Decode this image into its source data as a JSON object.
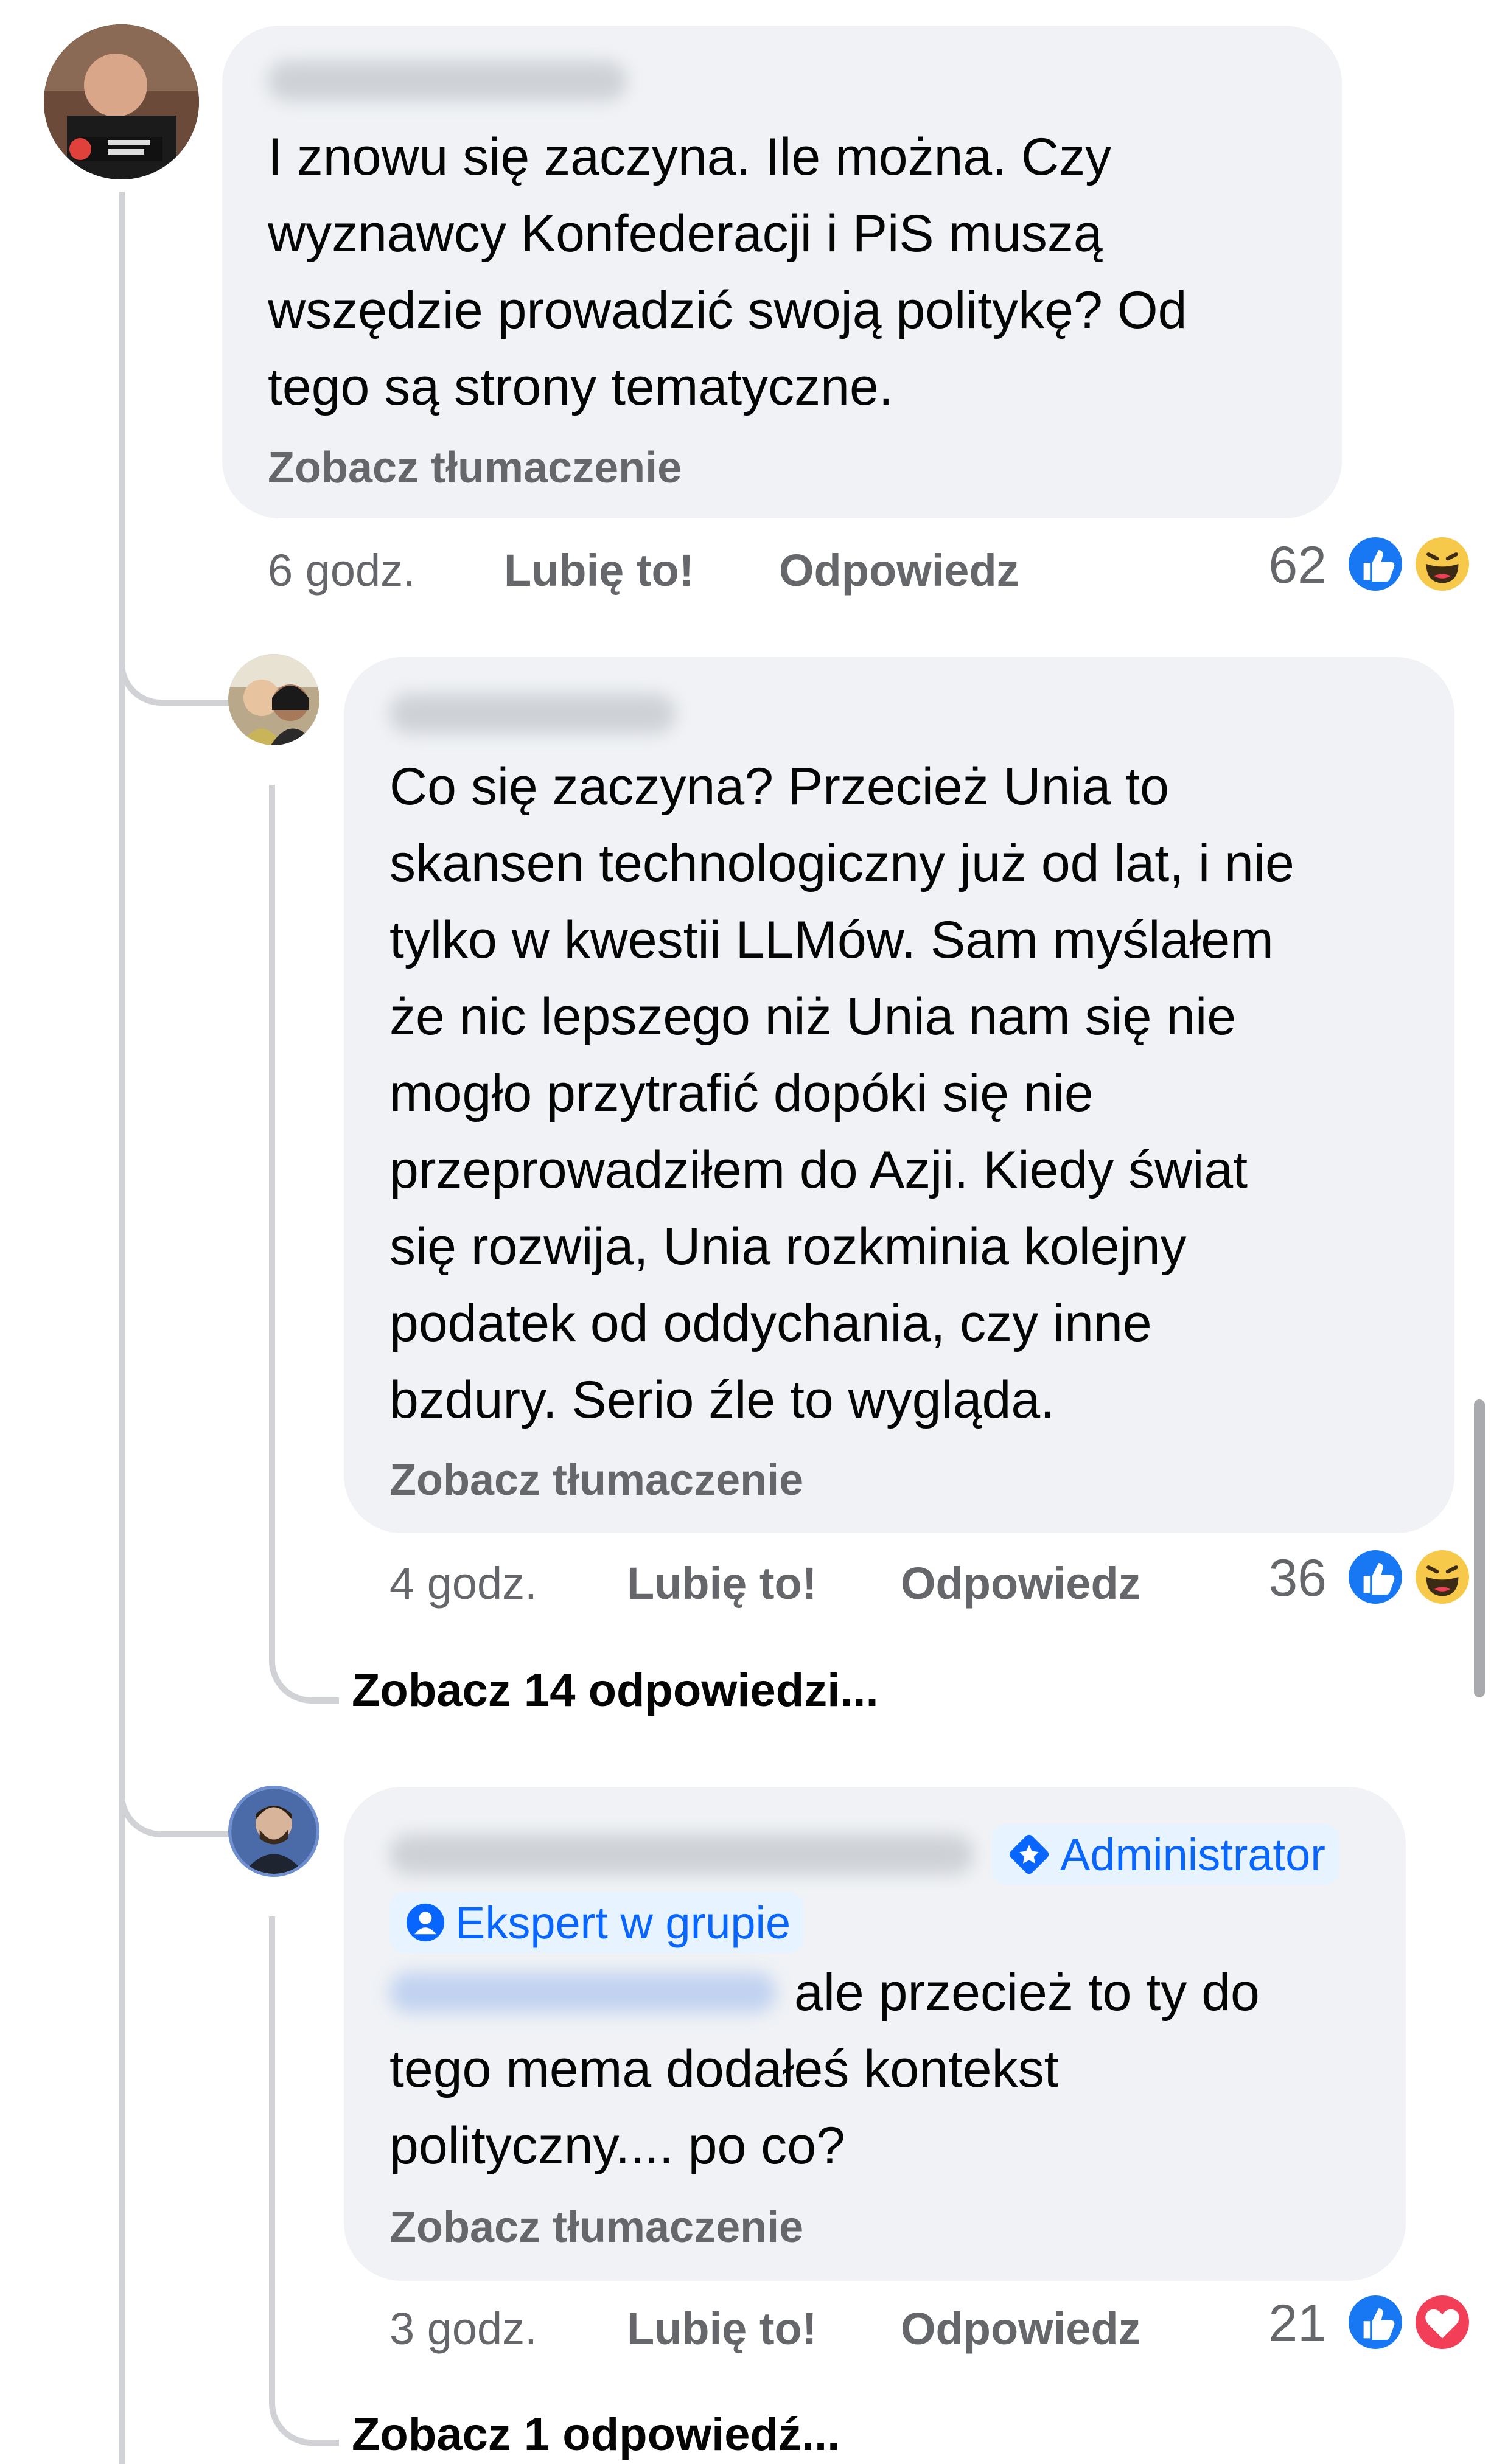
{
  "comments": [
    {
      "author": "Marcin Fiszbak",
      "text": "I znowu się zaczyna. Ile można. Czy\nwyznawcy Konfederacji i PiS muszą\nwszędzie prowadzić swoją politykę? Od\ntego są strony tematyczne.",
      "translate": "Zobacz tłumaczenie",
      "time": "6 godz.",
      "like": "Lubię to!",
      "reply": "Odpowiedz",
      "reactions_count": "62",
      "reactions": [
        "like-icon",
        "haha-icon"
      ]
    },
    {
      "author": "Michał Uffe",
      "text": "Co się zaczyna? Przecież Unia to\nskansen technologiczny już od lat, i nie\ntylko w kwestii LLMów. Sam myślałem\nże nic lepszego niż Unia nam się nie\nmogło przytrafić dopóki się nie\nprzeprowadziłem do Azji. Kiedy świat\nsię rozwija, Unia rozkminia kolejny\npodatek od oddychania, czy inne\nbzdury. Serio źle to wygląda.",
      "translate": "Zobacz tłumaczenie",
      "time": "4 godz.",
      "like": "Lubię to!",
      "reply": "Odpowiedz",
      "reactions_count": "36",
      "reactions": [
        "like-icon",
        "haha-icon"
      ],
      "view_replies": "Zobacz 14 odpowiedzi..."
    },
    {
      "author": "Krzysztof Wszystkomowski",
      "badge_admin": "Administrator",
      "badge_expert": "Ekspert w grupie",
      "mention": "Marcin Fiszbak",
      "text_first": "ale przecież to ty do",
      "text_rest": "tego mema dodałeś kontekst\npolityczny.... po co?",
      "translate": "Zobacz tłumaczenie",
      "time": "3 godz.",
      "like": "Lubię to!",
      "reply": "Odpowiedz",
      "reactions_count": "21",
      "reactions": [
        "like-icon",
        "love-icon"
      ],
      "view_replies": "Zobacz 1 odpowiedź..."
    }
  ],
  "colors": {
    "bubble": "#f0f2f5",
    "meta": "#65676b",
    "accent": "#0866ff",
    "like": "#1877f2",
    "love": "#f33e58",
    "haha": "#f7c94a"
  }
}
